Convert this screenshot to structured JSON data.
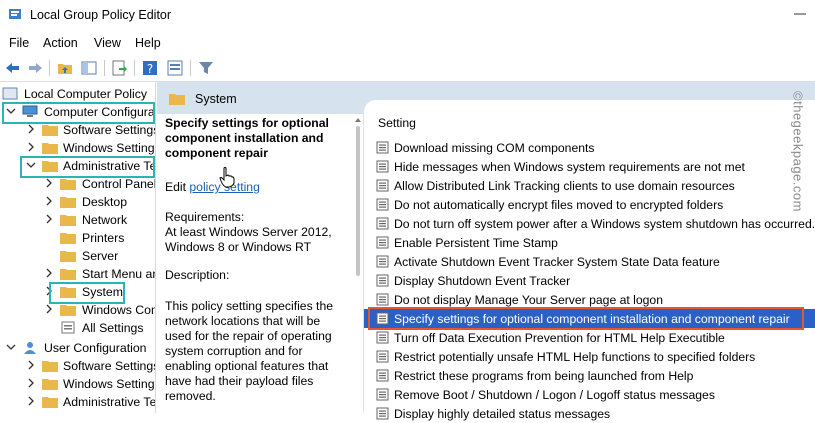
{
  "window": {
    "title": "Local Group Policy Editor"
  },
  "menu": [
    "File",
    "Action",
    "View",
    "Help"
  ],
  "tree": {
    "root": "Local Computer Policy",
    "items": [
      "Computer Configuration",
      "Software Settings",
      "Windows Settings",
      "Administrative Templates",
      "Control Panel",
      "Desktop",
      "Network",
      "Printers",
      "Server",
      "Start Menu and Taskbar",
      "System",
      "Windows Components",
      "All Settings",
      "User Configuration",
      "Software Settings",
      "Windows Settings",
      "Administrative Templates"
    ]
  },
  "header": {
    "title": "System"
  },
  "description": {
    "title": "Specify settings for optional component installation and component repair",
    "edit_prefix": "Edit",
    "edit_link": "policy setting",
    "req_label": "Requirements:",
    "req_text": "At least Windows Server 2012, Windows 8 or Windows RT",
    "desc_label": "Description:",
    "desc_text": "This policy setting specifies the network locations that will be used for the repair of operating system corruption and for enabling optional features that have had their payload files removed."
  },
  "settings": {
    "column": "Setting",
    "items": [
      "Download missing COM components",
      "Hide messages when Windows system requirements are not met",
      "Allow Distributed Link Tracking clients to use domain resources",
      "Do not automatically encrypt files moved to encrypted folders",
      "Do not turn off system power after a Windows system shutdown has occurred.",
      "Enable Persistent Time Stamp",
      "Activate Shutdown Event Tracker System State Data feature",
      "Display Shutdown Event Tracker",
      "Do not display Manage Your Server page at logon",
      "Specify settings for optional component installation and component repair",
      "Turn off Data Execution Prevention for HTML Help Executible",
      "Restrict potentially unsafe HTML Help functions to specified folders",
      "Restrict these programs from being launched from Help",
      "Remove Boot / Shutdown / Logon / Logoff status messages",
      "Display highly detailed status messages"
    ],
    "selected_index": 9
  },
  "watermark": "©thegeekpage.com",
  "colors": {
    "highlight_box": "#2ab5b5",
    "selected_row": "#2b61c6",
    "red_box": "#e5572d",
    "header_bg": "#d7e2ef",
    "folder": "#e8b84a"
  }
}
